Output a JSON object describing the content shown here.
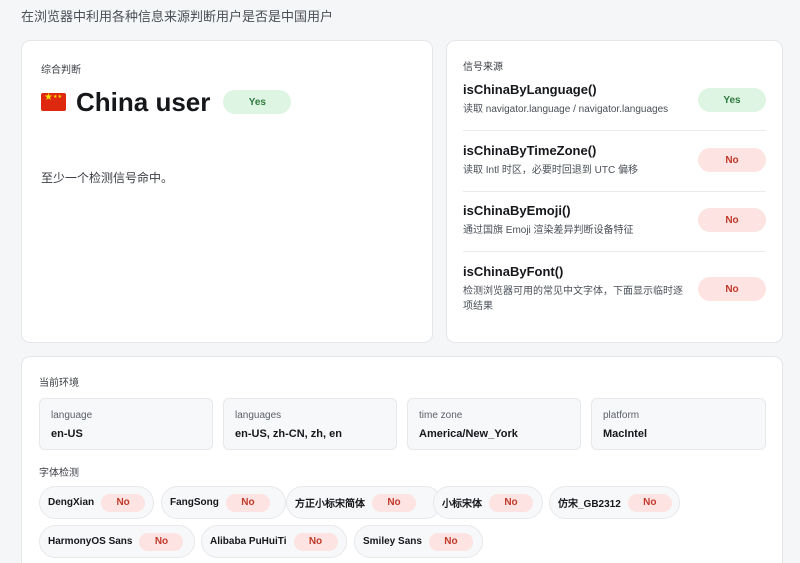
{
  "page": {
    "subtitle": "在浏览器中利用各种信息来源判断用户是否是中国用户"
  },
  "summary": {
    "label": "综合判断",
    "flag_icon": "china-flag-icon",
    "title": "China user",
    "result": "Yes",
    "description": "至少一个检测信号命中。"
  },
  "signals": {
    "label": "信号来源",
    "items": [
      {
        "name": "isChinaByLanguage()",
        "desc": "读取 navigator.language / navigator.languages",
        "result": "Yes"
      },
      {
        "name": "isChinaByTimeZone()",
        "desc": "读取 Intl 时区，必要时回退到 UTC 偏移",
        "result": "No"
      },
      {
        "name": "isChinaByEmoji()",
        "desc": "通过国旗 Emoji 渲染差异判断设备特征",
        "result": "No"
      },
      {
        "name": "isChinaByFont()",
        "desc": "检测浏览器可用的常见中文字体，下面显示临时逐项结果",
        "result": "No"
      }
    ]
  },
  "environment": {
    "label": "当前环境",
    "fields": [
      {
        "key": "language",
        "value": "en-US"
      },
      {
        "key": "languages",
        "value": "en-US, zh-CN, zh, en"
      },
      {
        "key": "time zone",
        "value": "America/New_York"
      },
      {
        "key": "platform",
        "value": "MacIntel"
      }
    ],
    "font_check_label": "字体检测",
    "fonts": [
      {
        "name": "DengXian",
        "result": "No"
      },
      {
        "name": "FangSong",
        "result": "No"
      },
      {
        "name": "方正小标宋简体",
        "result": "No"
      },
      {
        "name": "小标宋体",
        "result": "No"
      },
      {
        "name": "仿宋_GB2312",
        "result": "No"
      },
      {
        "name": "HarmonyOS Sans",
        "result": "No"
      },
      {
        "name": "Alibaba PuHuiTi",
        "result": "No"
      },
      {
        "name": "Smiley Sans",
        "result": "No"
      }
    ]
  },
  "colors": {
    "yes_bg": "#dff5e3",
    "yes_text": "#2d7a3e",
    "no_bg": "#fde3e1",
    "no_text": "#c0392b"
  }
}
